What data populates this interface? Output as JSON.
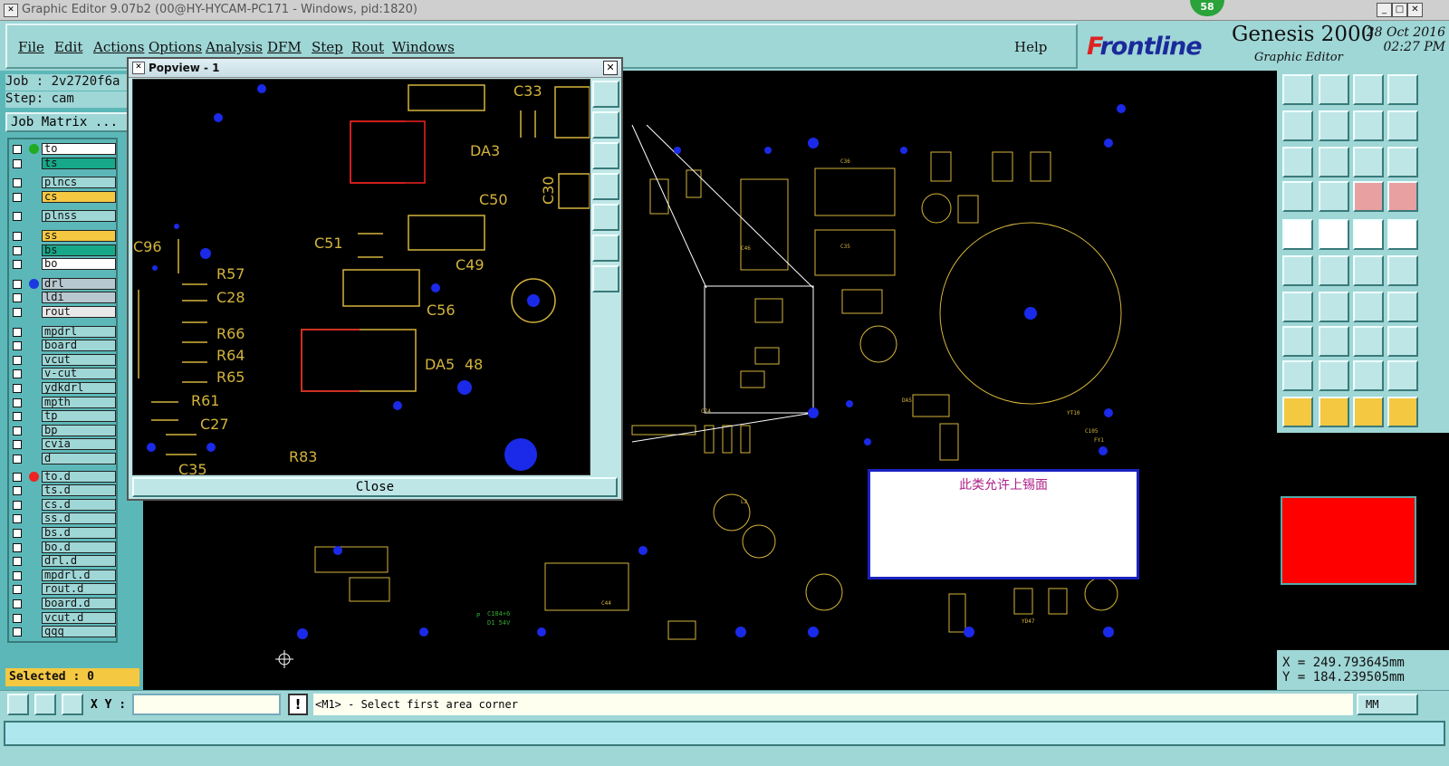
{
  "window": {
    "title": "Graphic Editor 9.07b2 (00@HY-HYCAM-PC171 - Windows, pid:1820)",
    "badge": "58"
  },
  "menu": [
    "File",
    "Edit",
    "Actions",
    "Options",
    "Analysis",
    "DFM",
    "Step",
    "Rout",
    "Windows"
  ],
  "help": "Help",
  "brand": {
    "logo_prefix": "F",
    "logo_rest": "rontline",
    "product": "Genesis 2000",
    "subtitle": "Graphic Editor",
    "date": "28 Oct 2016",
    "time": "02:27 PM"
  },
  "job": {
    "job_line": "Job : 2v2720f6a",
    "step_line": "Step: cam",
    "matrix_button": "Job Matrix ..."
  },
  "layers": [
    {
      "name": "to",
      "color": "#ffffff",
      "dot": "#22aa22"
    },
    {
      "name": "ts",
      "color": "#17a889",
      "dot": ""
    },
    {
      "name": "plncs",
      "color": "#9fd6d6",
      "dot": ""
    },
    {
      "name": "cs",
      "color": "#f5c842",
      "dot": ""
    },
    {
      "name": "plnss",
      "color": "#9fd6d6",
      "dot": ""
    },
    {
      "name": "ss",
      "color": "#f5c842",
      "dot": ""
    },
    {
      "name": "bs",
      "color": "#17a889",
      "dot": ""
    },
    {
      "name": "bo",
      "color": "#ffffff",
      "dot": ""
    },
    {
      "name": "drl",
      "color": "#b8c8d0",
      "dot": "#1a3ae0"
    },
    {
      "name": "ldi",
      "color": "#b8c8d0",
      "dot": ""
    },
    {
      "name": "rout",
      "color": "#e8e8e8",
      "dot": ""
    },
    {
      "name": "mpdrl",
      "color": "#9fd6d6",
      "dot": ""
    },
    {
      "name": "board",
      "color": "#9fd6d6",
      "dot": ""
    },
    {
      "name": "vcut",
      "color": "#9fd6d6",
      "dot": ""
    },
    {
      "name": "v-cut",
      "color": "#9fd6d6",
      "dot": ""
    },
    {
      "name": "ydkdrl",
      "color": "#9fd6d6",
      "dot": ""
    },
    {
      "name": "mpth",
      "color": "#9fd6d6",
      "dot": ""
    },
    {
      "name": "tp",
      "color": "#9fd6d6",
      "dot": ""
    },
    {
      "name": "bp",
      "color": "#9fd6d6",
      "dot": ""
    },
    {
      "name": "cvia",
      "color": "#9fd6d6",
      "dot": ""
    },
    {
      "name": "d",
      "color": "#9fd6d6",
      "dot": ""
    },
    {
      "name": "to.d",
      "color": "#9fd6d6",
      "dot": "#ee2222"
    },
    {
      "name": "ts.d",
      "color": "#9fd6d6",
      "dot": ""
    },
    {
      "name": "cs.d",
      "color": "#9fd6d6",
      "dot": ""
    },
    {
      "name": "ss.d",
      "color": "#9fd6d6",
      "dot": ""
    },
    {
      "name": "bs.d",
      "color": "#9fd6d6",
      "dot": ""
    },
    {
      "name": "bo.d",
      "color": "#9fd6d6",
      "dot": ""
    },
    {
      "name": "drl.d",
      "color": "#9fd6d6",
      "dot": ""
    },
    {
      "name": "mpdrl.d",
      "color": "#9fd6d6",
      "dot": ""
    },
    {
      "name": "rout.d",
      "color": "#9fd6d6",
      "dot": ""
    },
    {
      "name": "board.d",
      "color": "#9fd6d6",
      "dot": ""
    },
    {
      "name": "vcut.d",
      "color": "#9fd6d6",
      "dot": ""
    },
    {
      "name": "qqq",
      "color": "#9fd6d6",
      "dot": ""
    }
  ],
  "selected": "Selected : 0",
  "popview": {
    "title": "Popview - 1",
    "close": "Close",
    "labels": [
      "C33",
      "DA3",
      "C50",
      "C30",
      "C51",
      "C49",
      "C56",
      "R57",
      "C28",
      "R66",
      "R64",
      "R65",
      "DA5",
      "48",
      "R61",
      "C27",
      "R83",
      "C35",
      "C96"
    ]
  },
  "note": "此类允许上锡面",
  "coords": {
    "x": "X =  249.793645mm",
    "y": "Y =  184.239505mm"
  },
  "bottom": {
    "xy_label": "X Y :",
    "prompt": "<M1> - Select first area corner",
    "unit": "MM"
  },
  "colors": {
    "panel": "#9fd6d6",
    "layer_text": "#d4b43c",
    "pad": "#1a2ae8",
    "highlight": "#ff0000"
  }
}
